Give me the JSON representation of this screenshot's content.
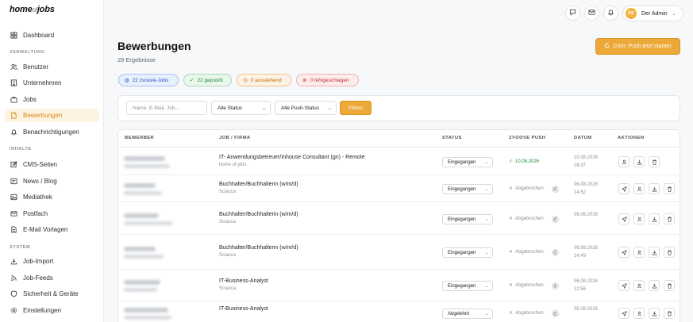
{
  "brand": {
    "logo_home": "home",
    "logo_of": "of",
    "logo_jobs": "jobs"
  },
  "sidebar": {
    "items_top": [
      {
        "label": "Dashboard",
        "icon": "grid-icon"
      }
    ],
    "section_verwaltung": "VERWALTUNG",
    "verwaltung": [
      {
        "label": "Benutzer",
        "icon": "users-icon"
      },
      {
        "label": "Unternehmen",
        "icon": "building-icon"
      },
      {
        "label": "Jobs",
        "icon": "briefcase-icon"
      },
      {
        "label": "Bewerbungen",
        "icon": "file-icon",
        "active": true
      },
      {
        "label": "Benachrichtigungen",
        "icon": "bell-icon"
      }
    ],
    "section_inhalte": "INHALTE",
    "inhalte": [
      {
        "label": "CMS-Seiten",
        "icon": "edit-icon"
      },
      {
        "label": "News / Blog",
        "icon": "news-icon"
      },
      {
        "label": "Mediathek",
        "icon": "image-icon"
      },
      {
        "label": "Postfach",
        "icon": "mail-icon"
      },
      {
        "label": "E-Mail Vorlagen",
        "icon": "template-icon"
      }
    ],
    "section_system": "SYSTEM",
    "system": [
      {
        "label": "Job-Import",
        "icon": "download-icon"
      },
      {
        "label": "Job-Feeds",
        "icon": "rss-icon"
      },
      {
        "label": "Sicherheit & Geräte",
        "icon": "shield-icon"
      },
      {
        "label": "Einstellungen",
        "icon": "gear-icon"
      }
    ]
  },
  "topbar": {
    "user_initials": "DE",
    "user_name": "Der Admin"
  },
  "header": {
    "title": "Bewerbungen",
    "subtitle": "29 Ergebnisse",
    "cron_button": "Cron: Push jetzt starten"
  },
  "stats": {
    "zvoove": "22 zvoove-Jobs",
    "pushed": "22 gepusht",
    "pending": "0 ausstehend",
    "failed": "0 fehlgeschlagen"
  },
  "filters": {
    "search_placeholder": "Name, E-Mail, Job...",
    "status_value": "Alle Status",
    "push_value": "Alle Push-Status",
    "submit": "Filtern"
  },
  "table": {
    "headers": {
      "applicant": "BEWERBER",
      "job": "JOB / FIRMA",
      "status": "STATUS",
      "push": "ZVOOVE PUSH",
      "date": "DATUM",
      "actions": "AKTIONEN"
    },
    "rows": [
      {
        "job": "IT- Anwendungsbetreuer/Inhouse Consultant (gn) - Remote",
        "company": "home of jobs",
        "status": "Eingegangen",
        "push": "10.08.2026",
        "push_ok": true,
        "date": "10.08.2026",
        "time": "16:37"
      },
      {
        "job": "Buchhalter/Buchhalterin (w/m/d)",
        "company": "Sciacca",
        "status": "Eingegangen",
        "push": "Abgebrochen",
        "push_ok": false,
        "date": "06.08.2026",
        "time": "14:52"
      },
      {
        "job": "Buchhalter/Buchhalterin (w/m/d)",
        "company": "Sciacca",
        "status": "Eingegangen",
        "push": "Abgebrochen",
        "push_ok": false,
        "date": "06.08.2026",
        "time": ""
      },
      {
        "job": "Buchhalter/Buchhalterin (w/m/d)",
        "company": "Sciacca",
        "status": "Eingegangen",
        "push": "Abgebrochen",
        "push_ok": false,
        "date": "06.08.2026",
        "time": "14:49"
      },
      {
        "job": "IT-Business-Analyst",
        "company": "Sciacca",
        "status": "Eingegangen",
        "push": "Abgebrochen",
        "push_ok": false,
        "date": "06.08.2026",
        "time": "12:56"
      },
      {
        "job": "IT-Business-Analyst",
        "company": "",
        "status": "Abgelehnt",
        "push": "Abgebrochen",
        "push_ok": false,
        "date": "05.08.2026",
        "time": ""
      }
    ]
  }
}
